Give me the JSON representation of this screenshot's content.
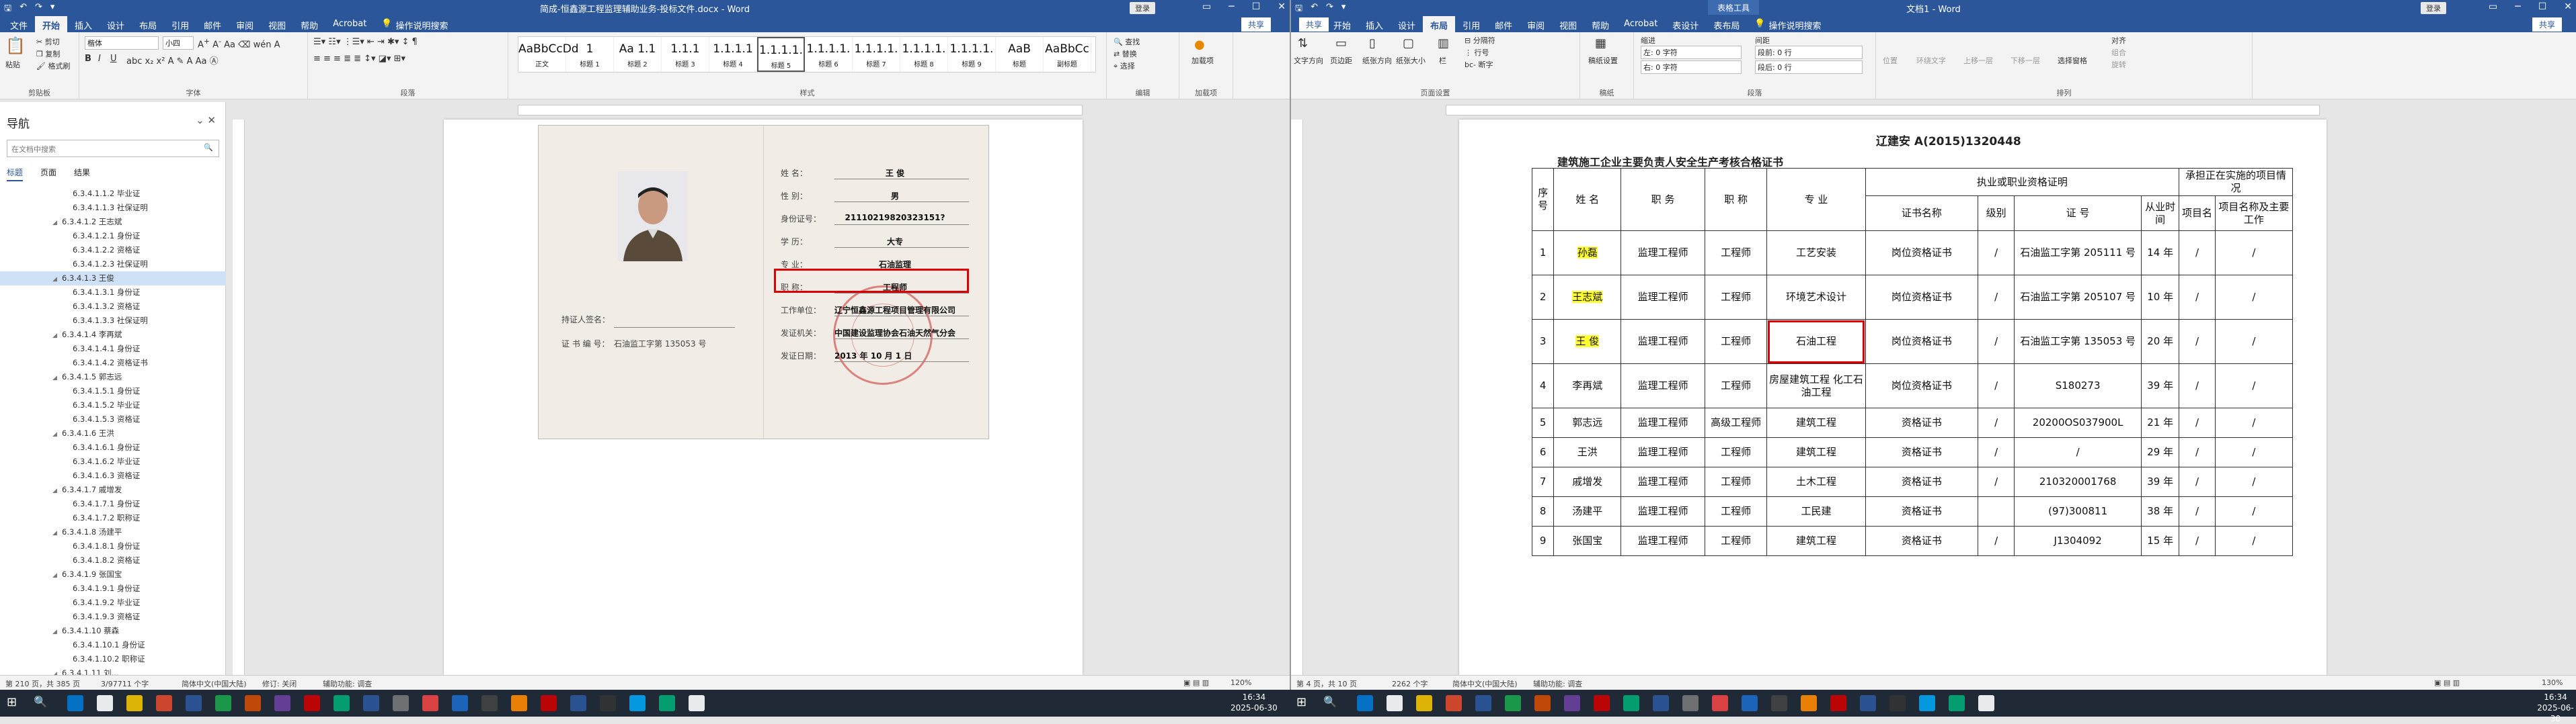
{
  "left_window": {
    "title": "简成-恒鑫源工程监理辅助业务-投标文件.docx - Word",
    "login": "登录",
    "tabs": [
      "文件",
      "开始",
      "插入",
      "设计",
      "布局",
      "引用",
      "邮件",
      "审阅",
      "视图",
      "帮助",
      "Acrobat"
    ],
    "active_tab": "开始",
    "tell_me": "操作说明搜索",
    "share": "共享",
    "clipboard": {
      "paste": "粘贴",
      "cut": "剪切",
      "copy": "复制",
      "format_painter": "格式刷",
      "label": "剪贴板"
    },
    "font": {
      "name": "楷体",
      "size": "小四",
      "label": "字体"
    },
    "paragraph_label": "段落",
    "styles": [
      {
        "preview": "AaBbCcDd",
        "name": "正文"
      },
      {
        "preview": "1",
        "name": "标题 1"
      },
      {
        "preview": "Aa 1.1",
        "name": "标题 2"
      },
      {
        "preview": "1.1.1",
        "name": "标题 3"
      },
      {
        "preview": "1.1.1.1",
        "name": "标题 4"
      },
      {
        "preview": "1.1.1.1.",
        "name": "标题 5"
      },
      {
        "preview": "1.1.1.1.",
        "name": "标题 6"
      },
      {
        "preview": "1.1.1.1.",
        "name": "标题 7"
      },
      {
        "preview": "1.1.1.1.",
        "name": "标题 8"
      },
      {
        "preview": "1.1.1.1.",
        "name": "标题 9"
      },
      {
        "preview": "AaB",
        "name": "标题"
      },
      {
        "preview": "AaBbCc",
        "name": "副标题"
      }
    ],
    "selected_style": "标题 5",
    "styles_label": "样式",
    "editing": {
      "find": "查找",
      "replace": "替换",
      "select": "选择",
      "label": "编辑"
    },
    "addins": {
      "btn": "加载项",
      "label": "加载项"
    },
    "status": {
      "page": "第 210 页，共 385 页",
      "words": "3/97711 个字",
      "lang": "简体中文(中国大陆)",
      "revisions": "修订: 关闭",
      "access": "辅助功能: 调查",
      "zoom": "120%"
    }
  },
  "nav": {
    "title": "导航",
    "search_placeholder": "在文档中搜索",
    "tabs": [
      "标题",
      "页面",
      "结果"
    ],
    "items": [
      {
        "t": "6.3.4.1.1.2 毕业证",
        "lv": 3
      },
      {
        "t": "6.3.4.1.1.3 社保证明",
        "lv": 3
      },
      {
        "t": "6.3.4.1.2 王志斌",
        "lv": 2,
        "arrow": true
      },
      {
        "t": "6.3.4.1.2.1 身份证",
        "lv": 3
      },
      {
        "t": "6.3.4.1.2.2 资格证",
        "lv": 3
      },
      {
        "t": "6.3.4.1.2.3 社保证明",
        "lv": 3
      },
      {
        "t": "6.3.4.1.3 王俊",
        "lv": 2,
        "arrow": true,
        "sel": true
      },
      {
        "t": "6.3.4.1.3.1 身份证",
        "lv": 3
      },
      {
        "t": "6.3.4.1.3.2 资格证",
        "lv": 3
      },
      {
        "t": "6.3.4.1.3.3 社保证明",
        "lv": 3
      },
      {
        "t": "6.3.4.1.4 李再斌",
        "lv": 2,
        "arrow": true
      },
      {
        "t": "6.3.4.1.4.1 身份证",
        "lv": 3
      },
      {
        "t": "6.3.4.1.4.2 资格证书",
        "lv": 3
      },
      {
        "t": "6.3.4.1.5 郭志远",
        "lv": 2,
        "arrow": true
      },
      {
        "t": "6.3.4.1.5.1 身份证",
        "lv": 3
      },
      {
        "t": "6.3.4.1.5.2 毕业证",
        "lv": 3
      },
      {
        "t": "6.3.4.1.5.3 资格证",
        "lv": 3
      },
      {
        "t": "6.3.4.1.6 王洪",
        "lv": 2,
        "arrow": true
      },
      {
        "t": "6.3.4.1.6.1 身份证",
        "lv": 3
      },
      {
        "t": "6.3.4.1.6.2 毕业证",
        "lv": 3
      },
      {
        "t": "6.3.4.1.6.3 资格证",
        "lv": 3
      },
      {
        "t": "6.3.4.1.7 戚增发",
        "lv": 2,
        "arrow": true
      },
      {
        "t": "6.3.4.1.7.1 身份证",
        "lv": 3
      },
      {
        "t": "6.3.4.1.7.2 职称证",
        "lv": 3
      },
      {
        "t": "6.3.4.1.8 汤建平",
        "lv": 2,
        "arrow": true
      },
      {
        "t": "6.3.4.1.8.1 身份证",
        "lv": 3
      },
      {
        "t": "6.3.4.1.8.2 资格证",
        "lv": 3
      },
      {
        "t": "6.3.4.1.9 张国宝",
        "lv": 2,
        "arrow": true
      },
      {
        "t": "6.3.4.1.9.1 身份证",
        "lv": 3
      },
      {
        "t": "6.3.4.1.9.2 毕业证",
        "lv": 3
      },
      {
        "t": "6.3.4.1.9.3 资格证",
        "lv": 3
      },
      {
        "t": "6.3.4.1.10 蔡森",
        "lv": 2,
        "arrow": true
      },
      {
        "t": "6.3.4.1.10.1 身份证",
        "lv": 3
      },
      {
        "t": "6.3.4.1.10.2 职称证",
        "lv": 3
      },
      {
        "t": "6.3.4.1.11 刘...",
        "lv": 2,
        "arrow": true
      }
    ]
  },
  "cert": {
    "left_holder": "持证人签名：",
    "left_no_label": "证 书 编 号：",
    "left_no": "石油监工字第   135053   号",
    "fields": [
      {
        "k": "姓        名：",
        "v": "王    俊"
      },
      {
        "k": "性        别：",
        "v": "男"
      },
      {
        "k": "身份证号：",
        "v": "21110219820323151?"
      },
      {
        "k": "学        历：",
        "v": "大专"
      },
      {
        "k": "专        业：",
        "v": "石油监理"
      },
      {
        "k": "职        称：",
        "v": "工程师"
      },
      {
        "k": "工作单位：",
        "v": "辽宁恒鑫源工程项目管理有限公司"
      },
      {
        "k": "发证机关：",
        "v": "中国建设监理协会石油天然气分会"
      },
      {
        "k": "发证日期：",
        "v": "2013 年 10 月 1 日"
      }
    ]
  },
  "right_window": {
    "title": "文档1 - Word",
    "context_tab": "表格工具",
    "login": "登录",
    "tabs": [
      "文件",
      "开始",
      "插入",
      "设计",
      "布局",
      "引用",
      "邮件",
      "审阅",
      "视图",
      "帮助",
      "Acrobat",
      "表设计",
      "表布局"
    ],
    "active_tab": "布局",
    "tell_me": "操作说明搜索",
    "share": "共享",
    "ribbon": {
      "text_dir": "文字方向",
      "margins": "页边距",
      "orientation": "纸张方向",
      "size": "纸张大小",
      "columns": "栏",
      "breaks": "分隔符",
      "line_no": "行号",
      "hyph": "断字",
      "page_setup": "页面设置",
      "draft": "稿纸设置",
      "draft_label": "稿纸",
      "indent": "缩进",
      "indent_left": "左: 0 字符",
      "indent_right": "右: 0 字符",
      "spacing": "间距",
      "before": "段前: 0 行",
      "after": "段后: 0 行",
      "para_label": "段落",
      "position": "位置",
      "wrap": "环绕文字",
      "forward": "上移一层",
      "backward": "下移一层",
      "sel_pane": "选择窗格",
      "align": "对齐",
      "group": "组合",
      "rotate": "旋转",
      "arrange": "排列"
    },
    "status": {
      "page": "第 4 页，共 10 页",
      "words": "2262 个字",
      "lang": "简体中文(中国大陆)",
      "access": "辅助功能: 调查",
      "zoom": "130%"
    }
  },
  "doc2": {
    "code": "辽建安 A(2015)1320448",
    "title": "建筑施工企业主要负责人安全生产考核合格证书",
    "header": {
      "seq": "序号",
      "name": "姓 名",
      "position": "职 务",
      "title": "职 称",
      "major": "专 业",
      "cert_group": "执业或职业资格证明",
      "cert_name": "证书名称",
      "level": "级别",
      "cert_no": "证 号",
      "years": "从业时间",
      "proj_group": "承担正在实施的项目情况",
      "proj": "项目名称及主要工作",
      "proj_col": "项目名"
    },
    "rows": [
      {
        "seq": "1",
        "name": "孙磊",
        "hl": true,
        "position": "监理工程师",
        "title": "工程师",
        "major": "工艺安装",
        "cert": "岗位资格证书",
        "level": "/",
        "no": "石油监工字第 205111 号",
        "years": "14 年",
        "p1": "/",
        "p2": "/"
      },
      {
        "seq": "2",
        "name": "王志斌",
        "hl": true,
        "position": "监理工程师",
        "title": "工程师",
        "major": "环境艺术设计",
        "cert": "岗位资格证书",
        "level": "/",
        "no": "石油监工字第 205107 号",
        "years": "10 年",
        "p1": "/",
        "p2": "/"
      },
      {
        "seq": "3",
        "name": "王 俊",
        "hl": true,
        "position": "监理工程师",
        "title": "工程师",
        "major": "石油工程",
        "boxed": true,
        "cert": "岗位资格证书",
        "level": "/",
        "no": "石油监工字第 135053 号",
        "years": "20 年",
        "p1": "/",
        "p2": "/"
      },
      {
        "seq": "4",
        "name": "李再斌",
        "position": "监理工程师",
        "title": "工程师",
        "major": "房屋建筑工程 化工石油工程",
        "cert": "岗位资格证书",
        "level": "/",
        "no": "S180273",
        "years": "39 年",
        "p1": "/",
        "p2": "/"
      },
      {
        "seq": "5",
        "name": "郭志远",
        "position": "监理工程师",
        "title": "高级工程师",
        "major": "建筑工程",
        "cert": "资格证书",
        "level": "/",
        "no": "20200OS037900L",
        "years": "21 年",
        "p1": "/",
        "p2": "/"
      },
      {
        "seq": "6",
        "name": "王洪",
        "position": "监理工程师",
        "title": "工程师",
        "major": "建筑工程",
        "cert": "资格证书",
        "level": "/",
        "no": "/",
        "years": "29 年",
        "p1": "/",
        "p2": "/"
      },
      {
        "seq": "7",
        "name": "戚增发",
        "position": "监理工程师",
        "title": "工程师",
        "major": "土木工程",
        "cert": "资格证书",
        "level": "/",
        "no": "210320001768",
        "years": "39 年",
        "p1": "/",
        "p2": "/"
      },
      {
        "seq": "8",
        "name": "汤建平",
        "position": "监理工程师",
        "title": "工程师",
        "major": "工民建",
        "cert": "资格证书",
        "level": "",
        "no": "(97)300811",
        "years": "38 年",
        "p1": "/",
        "p2": "/"
      },
      {
        "seq": "9",
        "name": "张国宝",
        "position": "监理工程师",
        "title": "工程师",
        "major": "建筑工程",
        "cert": "资格证书",
        "level": "/",
        "no": "J1304092",
        "years": "15 年",
        "p1": "/",
        "p2": "/"
      }
    ]
  },
  "taskbar": {
    "left_clock": {
      "time": "16:34",
      "date": "2025-06-30"
    },
    "right_clock": {
      "time": "16:34",
      "date": "2025-06-30"
    }
  },
  "colors": {
    "word_blue": "#2b579a",
    "highlight": "#ffff33",
    "red_box": "#dd0000"
  }
}
